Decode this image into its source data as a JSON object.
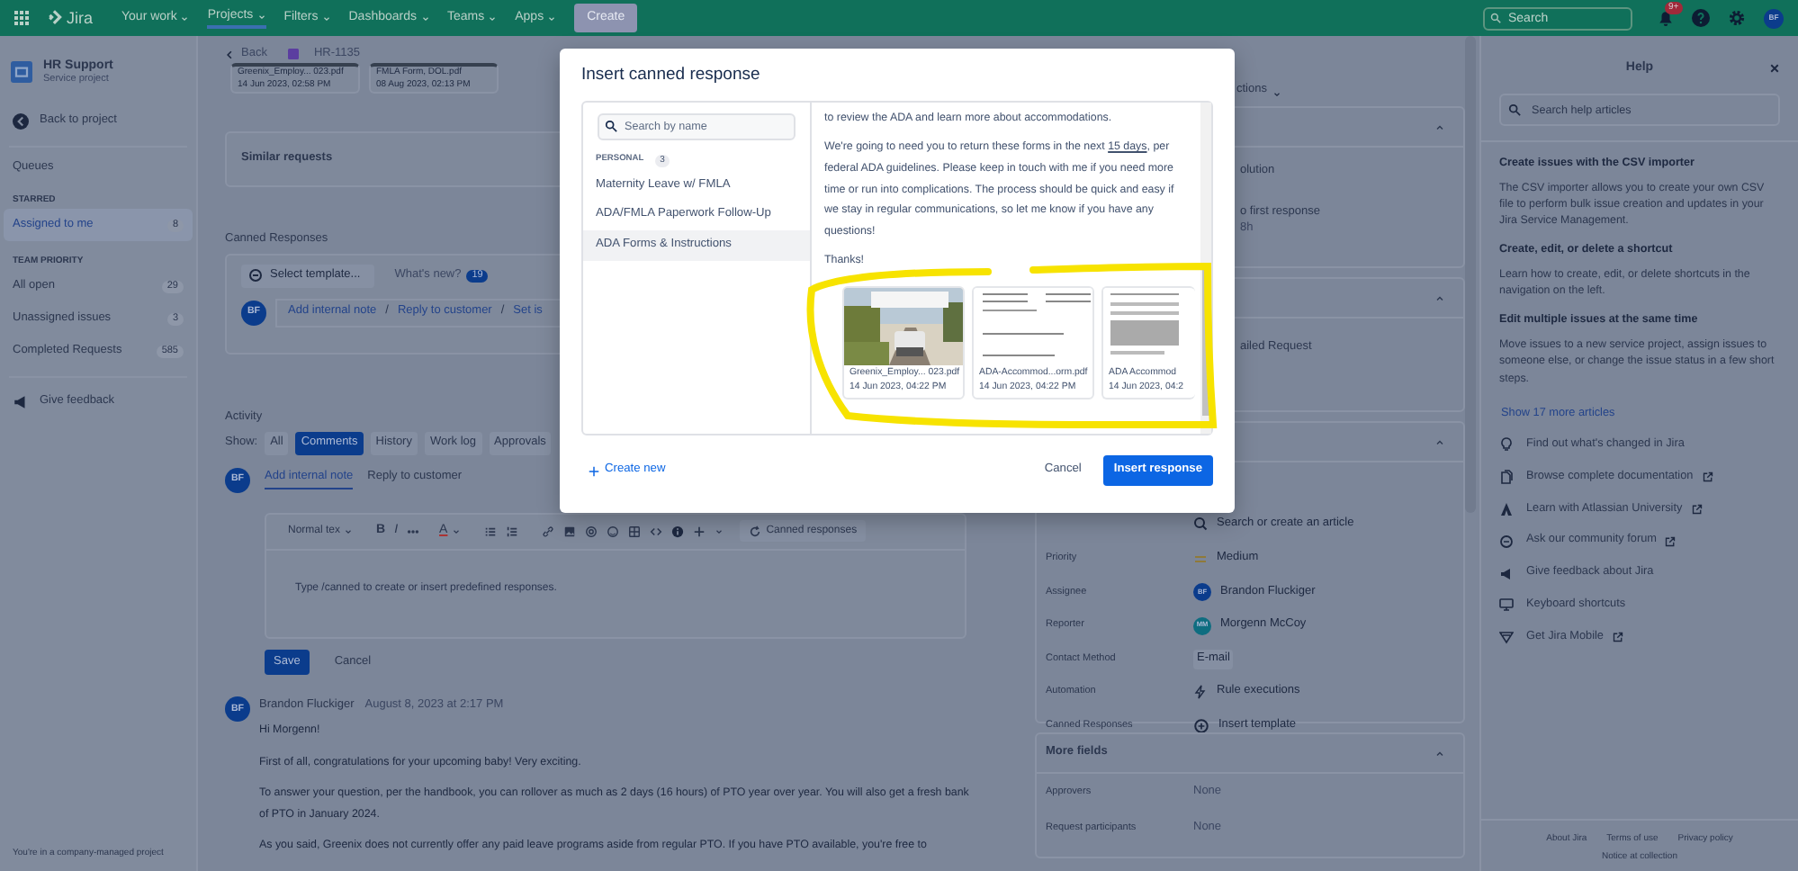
{
  "top_nav": {
    "product": "Jira",
    "items": [
      {
        "label": "Your work",
        "selected": false
      },
      {
        "label": "Projects",
        "selected": true
      },
      {
        "label": "Filters",
        "selected": false
      },
      {
        "label": "Dashboards",
        "selected": false
      },
      {
        "label": "Teams",
        "selected": false
      },
      {
        "label": "Apps",
        "selected": false
      }
    ],
    "create": "Create",
    "search": {
      "placeholder": "Search"
    },
    "notifications": "9+",
    "avatar": "BF"
  },
  "sidebar": {
    "project": "HR Support",
    "project_type": "Service project",
    "back": "Back to project",
    "queues": "Queues",
    "sections": [
      {
        "heading": "STARRED",
        "items": [
          {
            "label": "Assigned to me",
            "count": "8",
            "selected": true
          }
        ]
      },
      {
        "heading": "TEAM PRIORITY",
        "items": [
          {
            "label": "All open",
            "count": "29",
            "selected": false
          },
          {
            "label": "Unassigned issues",
            "count": "3",
            "selected": false
          },
          {
            "label": "Completed Requests",
            "count": "585",
            "selected": false
          }
        ]
      }
    ],
    "feedback": "Give feedback",
    "footer": "You're in a company-managed project"
  },
  "issue": {
    "back": "Back",
    "key": "HR-1135",
    "attachments": [
      {
        "name": "Greenix_Employ... 023.pdf",
        "date": "14 Jun 2023, 02:58 PM"
      },
      {
        "name": "FMLA Form, DOL.pdf",
        "date": "08 Aug 2023, 02:13 PM"
      }
    ],
    "similar": "Similar requests",
    "canned": {
      "heading": "Canned Responses",
      "select": "Select template...",
      "whats_new": "What's new?",
      "badge": "19",
      "avatar": "BF",
      "actions": [
        "Add internal note",
        "Reply to customer",
        "Set is"
      ],
      "separator": "/"
    },
    "activity": {
      "heading": "Activity",
      "show": "Show:",
      "filters": [
        {
          "label": "All",
          "selected": false
        },
        {
          "label": "Comments",
          "selected": true
        },
        {
          "label": "History",
          "selected": false
        },
        {
          "label": "Work log",
          "selected": false
        },
        {
          "label": "Approvals",
          "selected": false
        }
      ],
      "tabs": [
        {
          "label": "Add internal note",
          "selected": true
        },
        {
          "label": "Reply to customer",
          "selected": false
        }
      ],
      "avatar": "BF",
      "editor": {
        "style": "Normal tex",
        "format": [
          "B",
          "I"
        ],
        "text_color_label": "A",
        "canned": "Canned responses",
        "placeholder": "Type /canned to create or insert predefined responses."
      },
      "save": "Save",
      "cancel": "Cancel"
    },
    "comments": [
      {
        "avatar": "BF",
        "author": "Brandon Fluckiger",
        "time": "August 8, 2023 at 2:17 PM",
        "paragraphs": [
          "Hi Morgenn!",
          "First of all, congratulations for your upcoming baby! Very exciting.",
          "To answer your question, per the handbook, you can rollover as much as 2 days (16 hours) of PTO year over year. You will also get a fresh bank of PTO in January 2024.",
          "As you said, Greenix does not currently offer any paid leave programs aside from regular PTO. If you have PTO available, you're free to"
        ]
      }
    ]
  },
  "details": {
    "actions": "ctions",
    "sla": [
      {
        "text": "olution"
      },
      {
        "text": "o first response",
        "sub": "8h"
      }
    ],
    "request_type": "ailed Request",
    "fields": [
      {
        "kind": "article",
        "value": "Search or create an article"
      },
      {
        "kind": "priority",
        "label": "Priority",
        "value": "Medium"
      },
      {
        "kind": "user",
        "label": "Assignee",
        "value": "Brandon Fluckiger",
        "avatar": "BF",
        "color": "#0b3c8c"
      },
      {
        "kind": "user",
        "label": "Reporter",
        "value": "Morgenn McCoy",
        "avatar": "MM",
        "color": "#0e6d80"
      },
      {
        "kind": "tag",
        "label": "Contact Method",
        "value": "E-mail"
      },
      {
        "kind": "automation",
        "label": "Automation",
        "value": "Rule executions"
      },
      {
        "kind": "template",
        "label": "Canned Responses",
        "value": "Insert template"
      }
    ],
    "more_fields": {
      "title": "More fields",
      "fields": [
        {
          "label": "Approvers",
          "value": "None"
        },
        {
          "label": "Request participants",
          "value": "None"
        }
      ]
    }
  },
  "help": {
    "title": "Help",
    "search": {
      "placeholder": "Search help articles"
    },
    "articles": [
      {
        "title": "Create issues with the CSV importer",
        "text": "The CSV importer allows you to create your own CSV file to perform bulk issue creation and updates in your Jira Service Management."
      },
      {
        "title": "Create, edit, or delete a shortcut",
        "text": "Learn how to create, edit, or delete shortcuts in the navigation on the left."
      },
      {
        "title": "Edit multiple issues at the same time",
        "text": "Move issues to a new service project, assign issues to someone else, or change the issue status in a few short steps."
      }
    ],
    "more": "Show 17 more articles",
    "links": [
      {
        "kind": "bulb",
        "label": "Find out what's changed in Jira",
        "external": false
      },
      {
        "kind": "doc",
        "label": "Browse complete documentation",
        "external": true
      },
      {
        "kind": "atlassian",
        "label": "Learn with Atlassian University",
        "external": true
      },
      {
        "kind": "chat",
        "label": "Ask our community forum",
        "external": true
      },
      {
        "kind": "megaphone",
        "label": "Give feedback about Jira",
        "external": false
      },
      {
        "kind": "screen",
        "label": "Keyboard shortcuts",
        "external": false
      },
      {
        "kind": "mobile",
        "label": "Get Jira Mobile",
        "external": true
      }
    ],
    "footer": [
      "About Jira",
      "Terms of use",
      "Privacy policy",
      "Notice at collection"
    ]
  },
  "modal": {
    "title": "Insert canned response",
    "search": {
      "placeholder": "Search by name"
    },
    "group": "PERSONAL",
    "group_count": "3",
    "templates": [
      {
        "label": "Maternity Leave w/ FMLA",
        "selected": false
      },
      {
        "label": "ADA/FMLA Paperwork Follow-Up",
        "selected": false
      },
      {
        "label": "ADA Forms & Instructions",
        "selected": true
      }
    ],
    "preview": {
      "lead": "to review the ADA and learn more about accommodations.",
      "paragraph": {
        "before": "We're going to need you to return these forms in the next ",
        "link": "15 days",
        "after": ", per federal ADA guidelines. Please keep in touch with me if you need more time or run into complications. The process should be quick and easy if we stay in regular communications, so let me know if you have any questions!"
      },
      "closing": "Thanks!",
      "attachments": [
        {
          "kind": "picture",
          "name": "Greenix_Employ... 023.pdf",
          "date": "14 Jun 2023, 04:22 PM"
        },
        {
          "kind": "form",
          "name": "ADA-Accommod...orm.pdf",
          "date": "14 Jun 2023, 04:22 PM"
        },
        {
          "kind": "text",
          "name": "ADA Accommod",
          "date": "14 Jun 2023, 04:2"
        }
      ]
    },
    "create": "Create new",
    "cancel": "Cancel",
    "insert": "Insert response"
  }
}
